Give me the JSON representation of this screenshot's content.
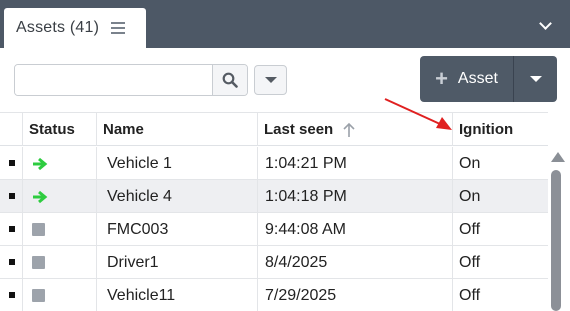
{
  "tab": {
    "label": "Assets (41)",
    "menu_icon": "hamburger-menu-icon"
  },
  "panel": {
    "collapse_icon": "chevron-down-icon"
  },
  "toolbar": {
    "search": {
      "value": "",
      "placeholder": ""
    },
    "search_icon": "magnifier-icon",
    "filter_icon": "caret-down-icon",
    "add_button": {
      "label": "Asset",
      "icon": "plus-icon"
    },
    "add_dropdown_icon": "caret-down-icon"
  },
  "table": {
    "columns": [
      {
        "label": "Status"
      },
      {
        "label": "Name"
      },
      {
        "label": "Last seen",
        "sort": "ascending"
      },
      {
        "label": "Ignition"
      }
    ],
    "rows": [
      {
        "status": "moving",
        "name": "Vehicle 1",
        "last_seen": "1:04:21 PM",
        "ignition": "On"
      },
      {
        "status": "moving",
        "name": "Vehicle 4",
        "last_seen": "1:04:18 PM",
        "ignition": "On"
      },
      {
        "status": "offline",
        "name": "FMC003",
        "last_seen": "9:44:08 AM",
        "ignition": "Off"
      },
      {
        "status": "offline",
        "name": "Driver1",
        "last_seen": "8/4/2025",
        "ignition": "Off"
      },
      {
        "status": "offline",
        "name": "Vehicle11",
        "last_seen": "7/29/2025",
        "ignition": "Off"
      }
    ]
  },
  "colors": {
    "header_bar": "#4d5866",
    "status_moving": "#2ecc40",
    "status_offline": "#9da3ab",
    "annotation_arrow": "#e02020"
  }
}
